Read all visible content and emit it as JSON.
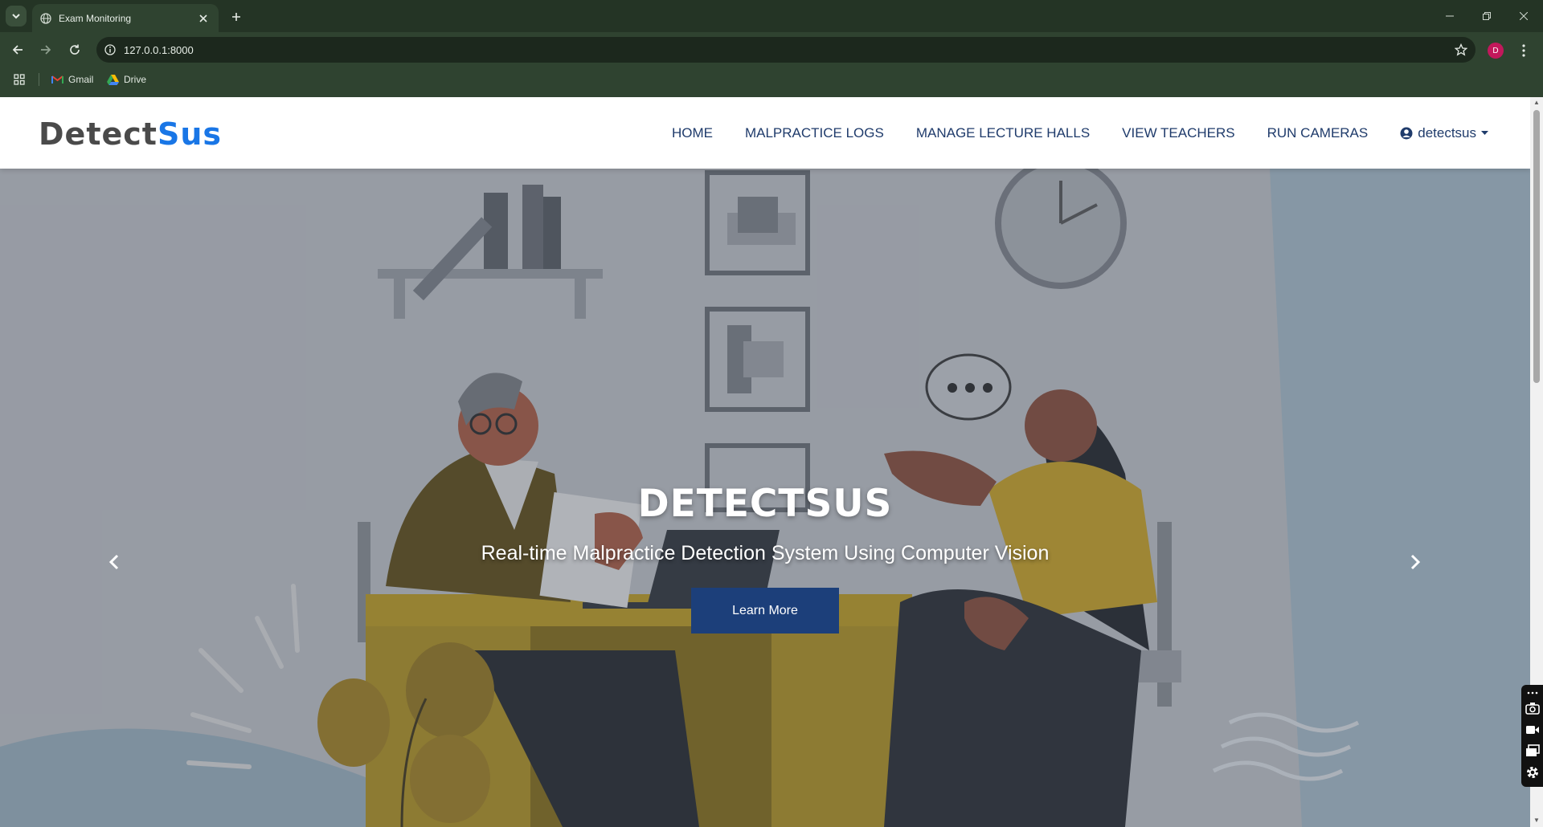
{
  "browser": {
    "tab_title": "Exam Monitoring",
    "url": "127.0.0.1:8000",
    "profile_initial": "D",
    "bookmarks": [
      {
        "label": "Gmail",
        "icon": "gmail-icon"
      },
      {
        "label": "Drive",
        "icon": "drive-icon"
      }
    ]
  },
  "navbar": {
    "logo_part1": "Detect",
    "logo_part2": "Sus",
    "links": [
      "HOME",
      "MALPRACTICE LOGS",
      "MANAGE LECTURE HALLS",
      "VIEW TEACHERS",
      "RUN CAMERAS"
    ],
    "user_label": "detectsus"
  },
  "hero": {
    "title": "DETECTSUS",
    "subtitle": "Real-time Malpractice Detection System Using Computer Vision",
    "button_label": "Learn More"
  },
  "colors": {
    "chrome_bg": "#2f4330",
    "logo_accent": "#1976e6",
    "nav_text": "#1f3b6b",
    "button_bg": "#1c3f7a"
  }
}
